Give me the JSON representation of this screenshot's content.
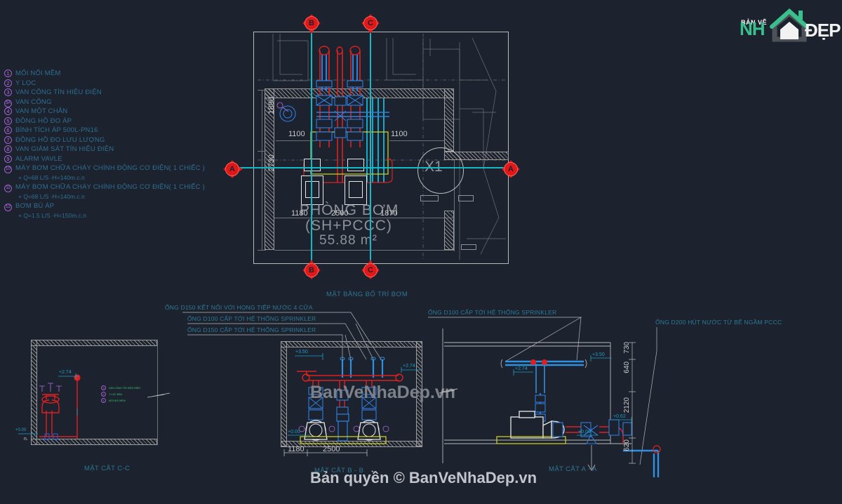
{
  "logo": {
    "top_text": "BẢN VẼ",
    "main_text": "NH",
    "suffix_text": "ĐẸP",
    "house_icon": "house-icon",
    "accent_color": "#39c08c"
  },
  "legend": {
    "items": [
      {
        "num": "1",
        "label": "MỐI NỐI MỀM"
      },
      {
        "num": "2",
        "label": "Y LỌC"
      },
      {
        "num": "3",
        "label": "VAN CỔNG TÍN HIỆU ĐIỆN"
      },
      {
        "num": "3A",
        "label": "VAN CỔNG"
      },
      {
        "num": "4",
        "label": "VAN MỘT CHẮN"
      },
      {
        "num": "5",
        "label": "ĐỒNG HỒ ĐO ÁP"
      },
      {
        "num": "6",
        "label": "BÌNH TÍCH ÁP 500L-PN16"
      },
      {
        "num": "7",
        "label": "ĐỒNG HỒ ĐO LƯU LƯỢNG"
      },
      {
        "num": "8",
        "label": "VAN GIÁM SÁT TÍN HIỆU ĐIỆN"
      },
      {
        "num": "9",
        "label": "ALARM VAVLE"
      },
      {
        "num": "10",
        "label": "MÁY BƠM CHỮA CHÁY CHÍNH ĐỘNG CƠ ĐIỆN( 1 CHIẾC )",
        "sub": "+ Q=68 L/S -H=140m.c.n"
      },
      {
        "num": "11",
        "label": "MÁY BƠM CHỮA CHÁY CHÍNH ĐỘNG CƠ ĐIỆN( 1 CHIẾC )",
        "sub": "+ Q=68 L/S -H=140m.c.n"
      },
      {
        "num": "12",
        "label": "BƠM BÙ ÁP",
        "sub": "+ Q=1.5 L/S -H=150m.c.n"
      }
    ]
  },
  "plan": {
    "title": "MẶT BẰNG BỐ TRÍ BƠM",
    "room_name": "PHÒNG BƠM",
    "room_sub": "(SH+PCCC)",
    "room_area": "55.88 m²",
    "shaft_label": "X1",
    "dims": {
      "left_top": "1890",
      "left_bottom": "2730",
      "inner_left": "1100",
      "inner_right": "1100",
      "bottom_1": "1180",
      "bottom_2": "2500",
      "bottom_3": "1870"
    },
    "markers": {
      "top_left": "B",
      "top_right": "C",
      "bottom_left": "B",
      "bottom_right": "C",
      "side_left": "A",
      "side_right": "A"
    }
  },
  "section_cc": {
    "title": "MẶT CẮT C-C",
    "elev_top": "+2.74",
    "elev_bottom": "+0.00",
    "notes": [
      {
        "num": "3",
        "label": "VAN CỔNG TÍN HIỆU ĐIỆN"
      },
      {
        "num": "2",
        "label": "Y LỌC BẨN"
      },
      {
        "num": "1",
        "label": "MỐI NỐI MỀM"
      }
    ]
  },
  "section_bb": {
    "title": "MẶT CẮT B - B",
    "annotations": [
      "ỐNG D150 KẾT NỐI VỚI HỌNG TIẾP NƯỚC 4 CỬA",
      "ỐNG D100 CẤP TỚI HỆ THỐNG SPRINKLER",
      "ỐNG D150 CẤP TỚI HỆ THỐNG SPRINKLER"
    ],
    "elev_top": "+3.50",
    "elev_right": "+2.74",
    "elev_base": "+0.00",
    "dims": {
      "d1": "1180",
      "d2": "2500"
    }
  },
  "section_aa": {
    "title": "MẶT CẮT A - A",
    "annotation_left": "ỐNG D100 CẤP TỚI HỆ THỐNG SPRINKLER",
    "annotation_right": "ỐNG D200 HÚT NƯỚC TỪ BỂ NGẦM PCCC",
    "elev_a": "+3.50",
    "elev_b": "+2.74",
    "elev_c": "+0.62",
    "elev_d": "+0.00",
    "dims": {
      "d730": "730",
      "d640": "640",
      "d2120": "2120",
      "d620": "620"
    }
  },
  "watermarks": {
    "middle": "BanVeNhaDep.vn",
    "copyright": "Bản quyền © BanVeNhaDep.vn"
  },
  "colors": {
    "background": "#1c222e",
    "cyan": "#15b9c6",
    "red": "#e01818",
    "blue": "#2060e0",
    "lightblue": "#1f9ec4",
    "yellow": "#d8d820",
    "grey": "#9a9a9a",
    "teal_text": "#2f7694",
    "purple": "#b26fe0"
  }
}
